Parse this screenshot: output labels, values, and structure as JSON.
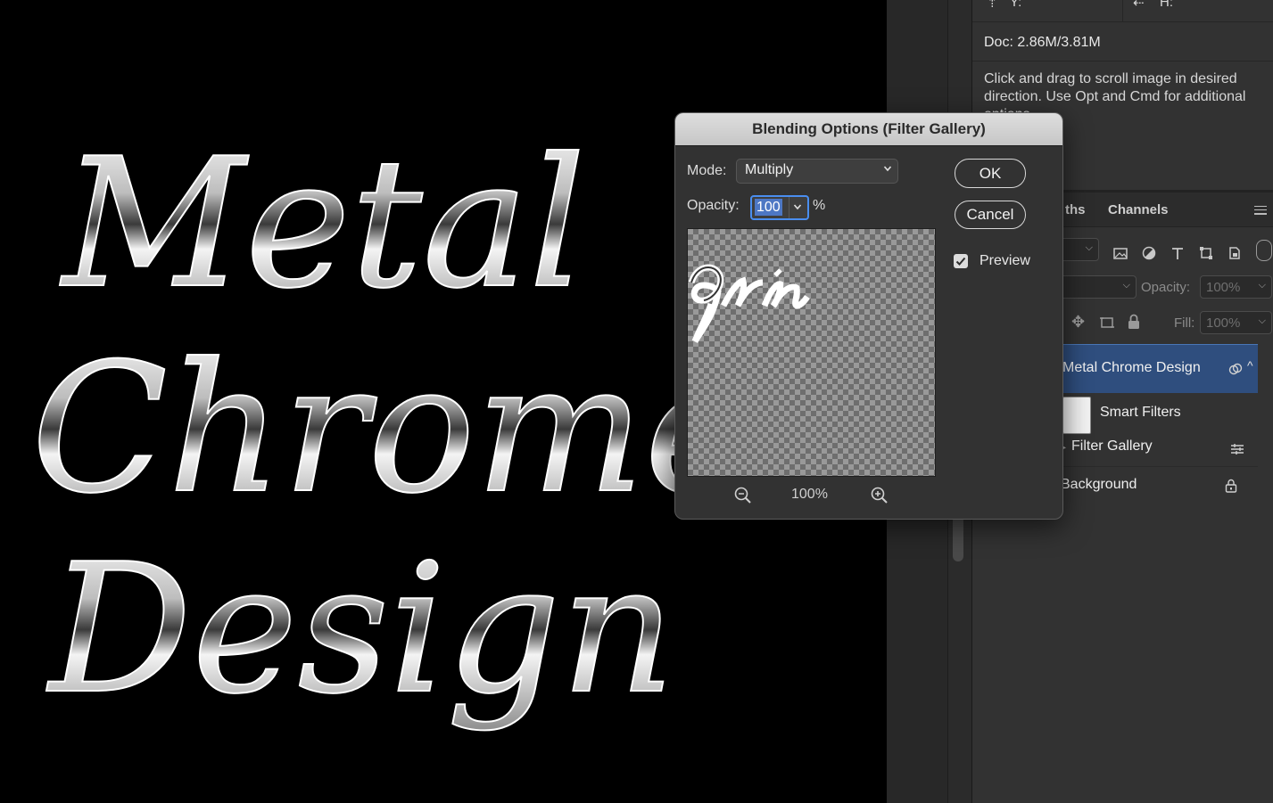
{
  "canvas": {
    "lines": [
      "Metal",
      "Chrome",
      "Design"
    ]
  },
  "info_panel": {
    "y_label": "Y:",
    "h_label": "H:",
    "doc_size": "Doc: 2.86M/3.81M",
    "hint": "Click and drag to scroll image in desired direction.  Use Opt and Cmd for additional options"
  },
  "layers_panel": {
    "tabs": [
      "ths",
      "Channels"
    ],
    "opacity_label": "Opacity:",
    "opacity_value": "100%",
    "fill_label": "Fill:",
    "fill_value": "100%",
    "layers": [
      {
        "name": "Metal  Chrome Design",
        "selected": true
      },
      {
        "name": "Smart Filters"
      },
      {
        "name": "Filter Gallery"
      },
      {
        "name": "Background"
      }
    ]
  },
  "dialog": {
    "title": "Blending Options (Filter Gallery)",
    "mode_label": "Mode:",
    "mode_value": "Multiply",
    "opacity_label": "Opacity:",
    "opacity_value": "100",
    "opacity_unit": "%",
    "zoom_value": "100%",
    "ok_label": "OK",
    "cancel_label": "Cancel",
    "preview_label": "Preview",
    "preview_checked": true
  },
  "icons": [
    "zoom-out-icon",
    "zoom-in-icon",
    "checkbox-icon",
    "chevron-down-icon",
    "panel-menu-icon",
    "lock-icon",
    "link-icon",
    "filter-options-icon"
  ]
}
